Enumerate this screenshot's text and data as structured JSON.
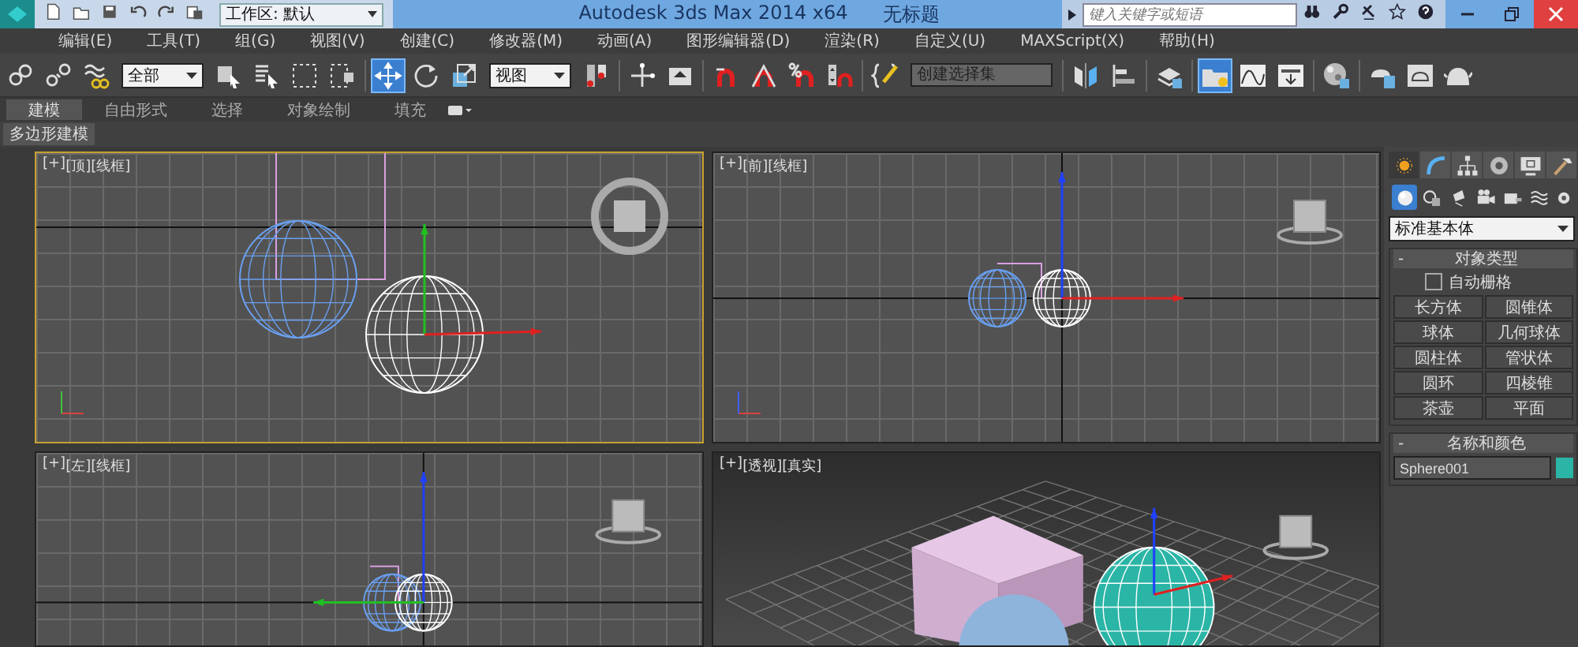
{
  "title_bar": {
    "workspace": "工作区: 默认",
    "title": "Autodesk 3ds Max  2014 x64",
    "document": "无标题",
    "search": {
      "placeholder": "键入关键字或短语"
    }
  },
  "menu_bar": [
    "编辑(E)",
    "工具(T)",
    "组(G)",
    "视图(V)",
    "创建(C)",
    "修改器(M)",
    "动画(A)",
    "图形编辑器(D)",
    "渲染(R)",
    "自定义(U)",
    "MAXScript(X)",
    "帮助(H)"
  ],
  "main_toolbar": {
    "groups": [
      [
        {
          "kind": "link",
          "selected": false
        },
        {
          "kind": "unlink",
          "selected": false
        },
        {
          "kind": "bind",
          "selected": false
        },
        {
          "kind": "dropdown",
          "value": "全部"
        },
        {
          "kind": "select",
          "selected": false
        },
        {
          "kind": "select-name",
          "selected": false
        },
        {
          "kind": "rect-region",
          "selected": false
        },
        {
          "kind": "window-crossing",
          "selected": false
        }
      ],
      [
        {
          "kind": "move",
          "selected": true
        },
        {
          "kind": "rotate",
          "selected": false
        },
        {
          "kind": "scale",
          "selected": false
        },
        {
          "kind": "dropdown",
          "value": "视图"
        },
        {
          "kind": "pivot",
          "selected": false
        }
      ],
      [
        {
          "kind": "manipulate",
          "selected": false
        },
        {
          "kind": "keyboard",
          "selected": false
        }
      ],
      [
        {
          "kind": "snap",
          "selected": false
        },
        {
          "kind": "angle-snap",
          "selected": false
        },
        {
          "kind": "percent-snap",
          "selected": false
        },
        {
          "kind": "spinner-snap",
          "selected": false
        }
      ],
      [
        {
          "kind": "named-sets",
          "selected": false
        },
        {
          "kind": "combo",
          "placeholder": "创建选择集"
        }
      ],
      [
        {
          "kind": "mirror",
          "selected": false
        },
        {
          "kind": "align",
          "selected": false
        }
      ],
      [
        {
          "kind": "layers",
          "selected": false
        }
      ],
      [
        {
          "kind": "explorer",
          "selected": true
        },
        {
          "kind": "curve",
          "selected": false
        },
        {
          "kind": "schematic",
          "selected": false
        }
      ],
      [
        {
          "kind": "material",
          "selected": false
        }
      ],
      [
        {
          "kind": "render-setup",
          "selected": false
        },
        {
          "kind": "frame-window",
          "selected": false
        },
        {
          "kind": "render",
          "selected": false
        }
      ]
    ]
  },
  "ribbon": {
    "tabs": [
      {
        "label": "建模",
        "selected": true
      },
      {
        "label": "自由形式",
        "selected": false
      },
      {
        "label": "选择",
        "selected": false
      },
      {
        "label": "对象绘制",
        "selected": false
      },
      {
        "label": "填充",
        "selected": false
      }
    ],
    "panel_tab": "多边形建模"
  },
  "viewports": [
    {
      "labels": [
        "[+]",
        "[顶]",
        "[线框]"
      ],
      "kind": "top",
      "active": true
    },
    {
      "labels": [
        "[+]",
        "[前]",
        "[线框]"
      ],
      "kind": "front",
      "active": false
    },
    {
      "labels": [
        "[+]",
        "[左]",
        "[线框]"
      ],
      "kind": "left",
      "active": false
    },
    {
      "labels": [
        "[+]",
        "[透视]",
        "[真实]"
      ],
      "kind": "perspective",
      "active": false
    }
  ],
  "command_panel": {
    "tabs": [
      {
        "kind": "create",
        "selected": true
      },
      {
        "kind": "modify",
        "selected": false
      },
      {
        "kind": "hierarchy",
        "selected": false
      },
      {
        "kind": "motion",
        "selected": false
      },
      {
        "kind": "display",
        "selected": false
      },
      {
        "kind": "utilities",
        "selected": false
      }
    ],
    "categories": [
      {
        "kind": "geometry",
        "selected": true
      },
      {
        "kind": "shapes",
        "selected": false
      },
      {
        "kind": "lights",
        "selected": false
      },
      {
        "kind": "cameras",
        "selected": false
      },
      {
        "kind": "helpers",
        "selected": false
      },
      {
        "kind": "spacewarps",
        "selected": false
      },
      {
        "kind": "systems",
        "selected": false
      }
    ],
    "type_dropdown": "标准基本体",
    "object_type": {
      "collapse": "-",
      "title": "对象类型",
      "autogrid": {
        "label": "自动栅格",
        "checked": false
      },
      "buttons": [
        "长方体",
        "圆锥体",
        "球体",
        "几何球体",
        "圆柱体",
        "管状体",
        "圆环",
        "四棱锥",
        "茶壶",
        "平面"
      ]
    },
    "name_and_color": {
      "collapse": "-",
      "title": "名称和颜色",
      "name": "Sphere001",
      "color": "#2bb5a6"
    }
  }
}
